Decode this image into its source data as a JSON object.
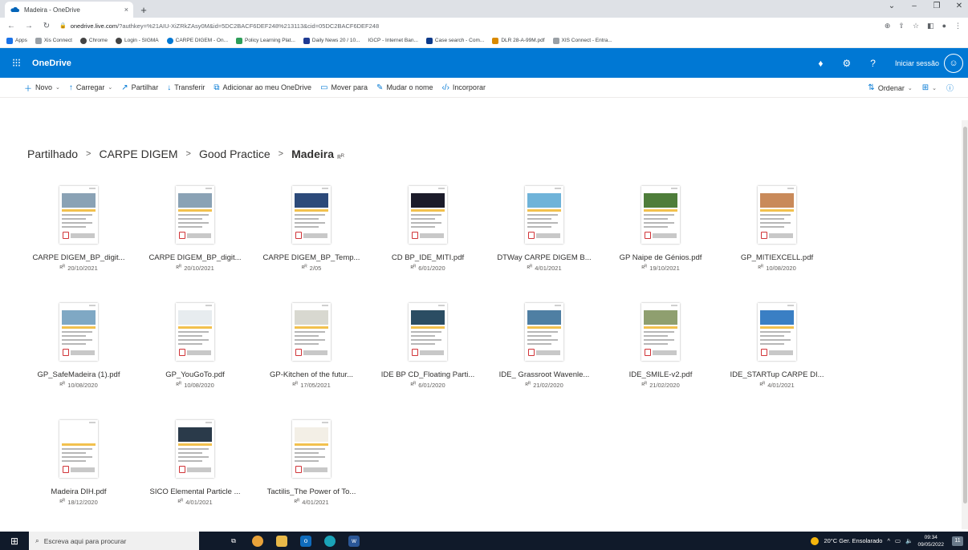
{
  "browser": {
    "tab_title": "Madeira - OneDrive",
    "tab_close": "×",
    "new_tab": "+",
    "url_host": "onedrive.live.com",
    "url_rest": "/?authkey=%21AIU-XiZRkZAsy0M&id=5DC2BACF6DEF248%213113&cid=05DC2BACF6DEF248",
    "bookmarks": [
      {
        "label": "Apps",
        "color": "#1a73e8"
      },
      {
        "label": "Xis Connect",
        "color": "#5f6368"
      },
      {
        "label": "Chrome",
        "color": "#444444"
      },
      {
        "label": "Login - SIGMA",
        "color": "#444444"
      },
      {
        "label": "CARPE DIGEM - On...",
        "color": "#0078d4"
      },
      {
        "label": "Policy Learning Plat...",
        "color": "#2e9e5a"
      },
      {
        "label": "Daily News 20 / 10...",
        "color": "#1f3a93"
      },
      {
        "label": "IGCP - Internet Ban...",
        "color": "#ffffff"
      },
      {
        "label": "Case search - Com...",
        "color": "#0d3a8a"
      },
      {
        "label": "DLR 28-A-99M.pdf",
        "color": "#d98a00"
      },
      {
        "label": "XIS Connect - Entra...",
        "color": "#5f6368"
      }
    ]
  },
  "suite": {
    "app_name": "OneDrive",
    "help": "?",
    "sign_in": "Iniciar sessão"
  },
  "commands": {
    "new": "Novo",
    "upload": "Carregar",
    "share": "Partilhar",
    "download": "Transferir",
    "add_to_onedrive": "Adicionar ao meu OneDrive",
    "move_to": "Mover para",
    "rename": "Mudar o nome",
    "embed": "Incorporar",
    "sort": "Ordenar"
  },
  "breadcrumb": {
    "items": [
      "Partilhado",
      "CARPE DIGEM",
      "Good Practice"
    ],
    "current": "Madeira",
    "separator": ">"
  },
  "files": [
    {
      "name": "CARPE DIGEM_BP_digit...",
      "date": "20/10/2021",
      "photo": "#8aa2b5"
    },
    {
      "name": "CARPE DIGEM_BP_digit...",
      "date": "20/10/2021",
      "photo": "#8aa2b5"
    },
    {
      "name": "CARPE DIGEM_BP_Temp...",
      "date": "2/05",
      "photo": "#2c4a7a"
    },
    {
      "name": "CD BP_IDE_MITI.pdf",
      "date": "6/01/2020",
      "photo": "#1b1b2a"
    },
    {
      "name": "DTWay CARPE DIGEM B...",
      "date": "4/01/2021",
      "photo": "#6fb3d9"
    },
    {
      "name": "GP Naipe de Génios.pdf",
      "date": "19/10/2021",
      "photo": "#4e7d3a"
    },
    {
      "name": "GP_MITIEXCELL.pdf",
      "date": "10/08/2020",
      "photo": "#c98a5a"
    },
    {
      "name": "GP_SafeMadeira (1).pdf",
      "date": "10/08/2020",
      "photo": "#7fa8c4"
    },
    {
      "name": "GP_YouGoTo.pdf",
      "date": "10/08/2020",
      "photo": "#e7ecef"
    },
    {
      "name": "GP-Kitchen of the futur...",
      "date": "17/05/2021",
      "photo": "#d8d8d0"
    },
    {
      "name": "IDE BP CD_Floating Parti...",
      "date": "6/01/2020",
      "photo": "#2b4d63"
    },
    {
      "name": "IDE_ Grassroot Wavenle...",
      "date": "21/02/2020",
      "photo": "#4f7fa3"
    },
    {
      "name": "IDE_SMILE-v2.pdf",
      "date": "21/02/2020",
      "photo": "#8f9f6f"
    },
    {
      "name": "IDE_STARTup CARPE DI...",
      "date": "4/01/2021",
      "photo": "#3a7fc4"
    },
    {
      "name": "Madeira DIH.pdf",
      "date": "18/12/2020",
      "photo": "#ffffff"
    },
    {
      "name": "SICO Elemental Particle ...",
      "date": "4/01/2021",
      "photo": "#2a3a4a"
    },
    {
      "name": "Tactilis_The Power of To...",
      "date": "4/01/2021",
      "photo": "#f3efe6"
    }
  ],
  "taskbar": {
    "search_placeholder": "Escreva aqui para procurar",
    "weather": "20°C  Ger. Ensolarado",
    "time": "09:34",
    "date": "09/05/2022",
    "notifications": "11"
  }
}
